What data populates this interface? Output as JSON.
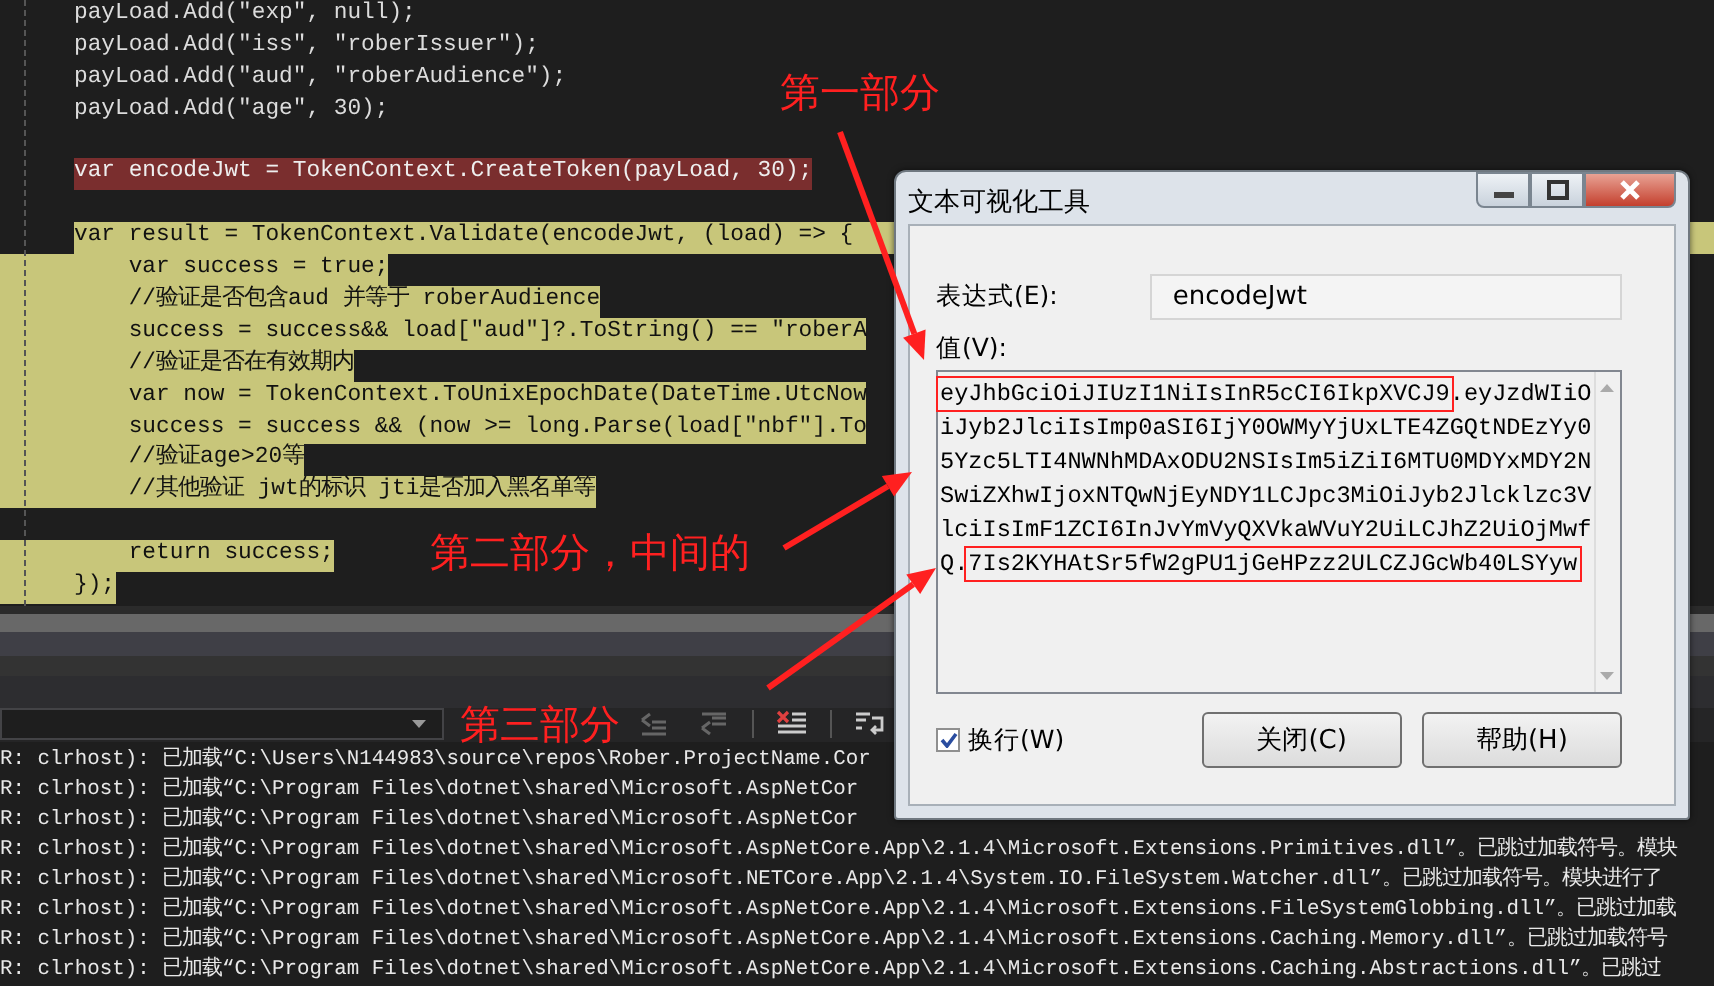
{
  "editor": {
    "lines": [
      {
        "text": "payLoad.Add(\"exp\", null);",
        "kind": "plain"
      },
      {
        "text": "payLoad.Add(\"iss\", \"roberIssuer\");",
        "kind": "plain"
      },
      {
        "text": "payLoad.Add(\"aud\", \"roberAudience\");",
        "kind": "plain"
      },
      {
        "text": "payLoad.Add(\"age\", 30);",
        "kind": "plain"
      },
      {
        "kind": "plain"
      },
      {
        "text": "var encodeJwt = TokenContext.CreateToken(payLoad, 30);",
        "kind": "breakpoint"
      },
      {
        "kind": "plain"
      },
      {
        "text": "var result = TokenContext.Validate(encodeJwt, (load) => {",
        "kind": "current"
      },
      {
        "text": "    var success = true;",
        "kind": "block"
      },
      {
        "text": "    //验证是否包含aud 并等于 roberAudience",
        "kind": "block"
      },
      {
        "text": "    success = success&& load[\"aud\"]?.ToString() == \"roberA",
        "kind": "block"
      },
      {
        "text": "    //验证是否在有效期内",
        "kind": "block"
      },
      {
        "text": "    var now = TokenContext.ToUnixEpochDate(DateTime.UtcNow",
        "kind": "block"
      },
      {
        "text": "    success = success && (now >= long.Parse(load[\"nbf\"].To",
        "kind": "block"
      },
      {
        "text": "    //验证age>20等",
        "kind": "block"
      },
      {
        "text": "    //其他验证 jwt的标识 jti是否加入黑名单等",
        "kind": "block"
      },
      {
        "kind": "plain"
      },
      {
        "text": "    return success;",
        "kind": "block"
      },
      {
        "text": "});",
        "kind": "block"
      }
    ]
  },
  "output": {
    "lines": [
      {
        "text": "R: clrhost): 已加载“C:\\Users\\N144983\\source\\repos\\Rober.ProjectName.Cor"
      },
      {
        "text": "R: clrhost): 已加载“C:\\Program Files\\dotnet\\shared\\Microsoft.AspNetCor"
      },
      {
        "text": "R: clrhost): 已加载“C:\\Program Files\\dotnet\\shared\\Microsoft.AspNetCor"
      },
      {
        "text": "R: clrhost): 已加载“C:\\Program Files\\dotnet\\shared\\Microsoft.AspNetCore.App\\2.1.4\\Microsoft.Extensions.Primitives.dll”。已跳过加载符号。模块"
      },
      {
        "text": "R: clrhost): 已加载“C:\\Program Files\\dotnet\\shared\\Microsoft.NETCore.App\\2.1.4\\System.IO.FileSystem.Watcher.dll”。已跳过加载符号。模块进行了"
      },
      {
        "text": "R: clrhost): 已加载“C:\\Program Files\\dotnet\\shared\\Microsoft.AspNetCore.App\\2.1.4\\Microsoft.Extensions.FileSystemGlobbing.dll”。已跳过加载"
      },
      {
        "text": "R: clrhost): 已加载“C:\\Program Files\\dotnet\\shared\\Microsoft.AspNetCore.App\\2.1.4\\Microsoft.Extensions.Caching.Memory.dll”。已跳过加载符号"
      },
      {
        "text": "R: clrhost): 已加载“C:\\Program Files\\dotnet\\shared\\Microsoft.AspNetCore.App\\2.1.4\\Microsoft.Extensions.Caching.Abstractions.dll”。已跳过"
      }
    ]
  },
  "dialog": {
    "title": "文本可视化工具",
    "expression_label": "表达式(E):",
    "expression": "encodeJwt",
    "value_label": "值(V):",
    "value_segments": [
      {
        "text": "eyJhbGciOiJIUzI1NiIsInR5cCI6IkpXVCJ9",
        "boxed": true
      },
      {
        "text": ".eyJzdWIiOiJyb2JlciIsImp0aSI6IjY0OWMyYjUxLTE4ZGQtNDEzYy05Yzc5LTI4NWNhMDAxODU2NSIsIm5iZiI6MTU0MDYxMDY2NSwiZXhwIjoxNTQwNjEyNDY1LCJpc3MiOiJyb2Jlcklzc3VlciIsImF1ZCI6InJvYmVyQXVkaWVuY2UiLCJhZ2UiOjMwfQ.",
        "boxed": false
      },
      {
        "text": "7Is2KYHAtSr5fW2gPU1jGeHPzz2ULCZJGcWb40LSYyw",
        "boxed": true
      }
    ],
    "wrap": {
      "label": "换行(W)",
      "checked": true
    },
    "buttons": [
      "关闭(C)",
      "帮助(H)"
    ]
  },
  "annotations": [
    {
      "text": "第一部分"
    },
    {
      "text": "第二部分，中间的"
    },
    {
      "text": "第三部分"
    }
  ]
}
